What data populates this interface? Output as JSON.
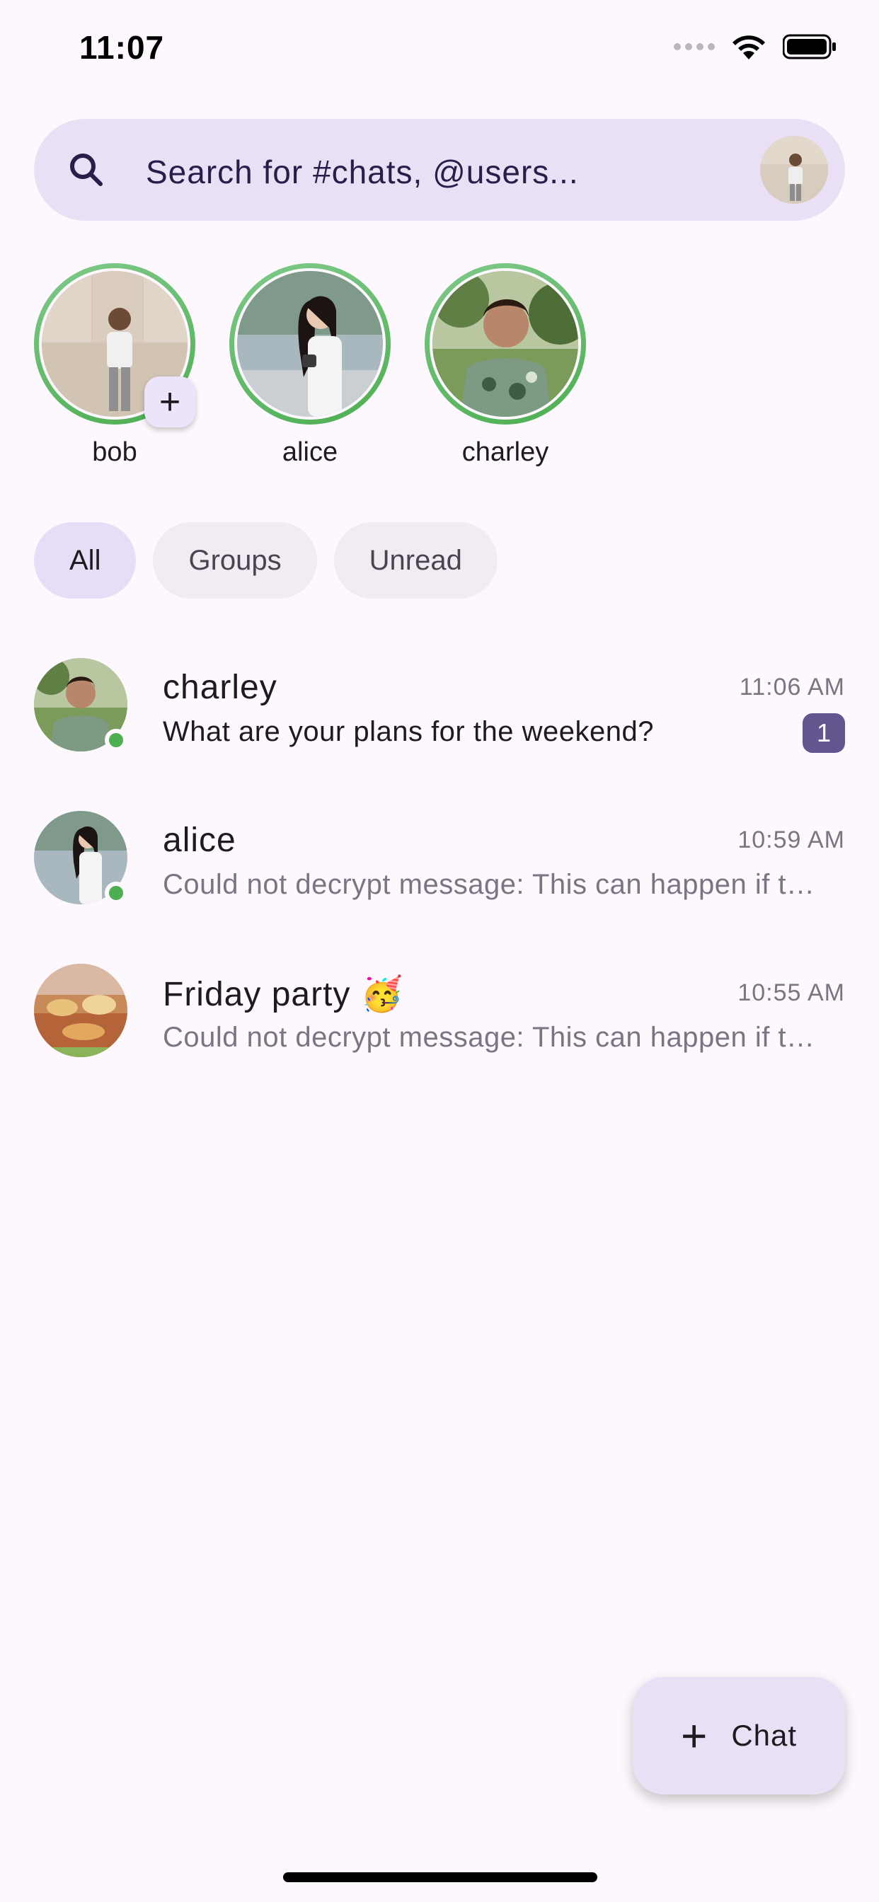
{
  "status_bar": {
    "time": "11:07"
  },
  "search": {
    "placeholder": "Search for #chats, @users..."
  },
  "stories": [
    {
      "name": "bob"
    },
    {
      "name": "alice"
    },
    {
      "name": "charley"
    }
  ],
  "story_add_label": "+",
  "filters": [
    {
      "label": "All",
      "selected": true
    },
    {
      "label": "Groups",
      "selected": false
    },
    {
      "label": "Unread",
      "selected": false
    }
  ],
  "chats": [
    {
      "name": "charley",
      "time": "11:06 AM",
      "preview": "What are your plans for the weekend?",
      "unread_count": "1",
      "online": true
    },
    {
      "name": "alice",
      "time": "10:59 AM",
      "preview": "Could not decrypt message: This can happen if the sender has not shared the keys",
      "online": true
    },
    {
      "name": "Friday party 🥳",
      "time": "10:55 AM",
      "preview": "Could not decrypt message: This can happen if the sender has not shared the keys",
      "online": false
    }
  ],
  "fab": {
    "icon": "+",
    "label": "Chat"
  },
  "colors": {
    "background": "#fdf8fd",
    "search_bg": "#e9e0f6",
    "chip_selected": "#e6ddf7",
    "badge": "#65558f",
    "online": "#4caf50",
    "story_ring": "#4caf50"
  }
}
